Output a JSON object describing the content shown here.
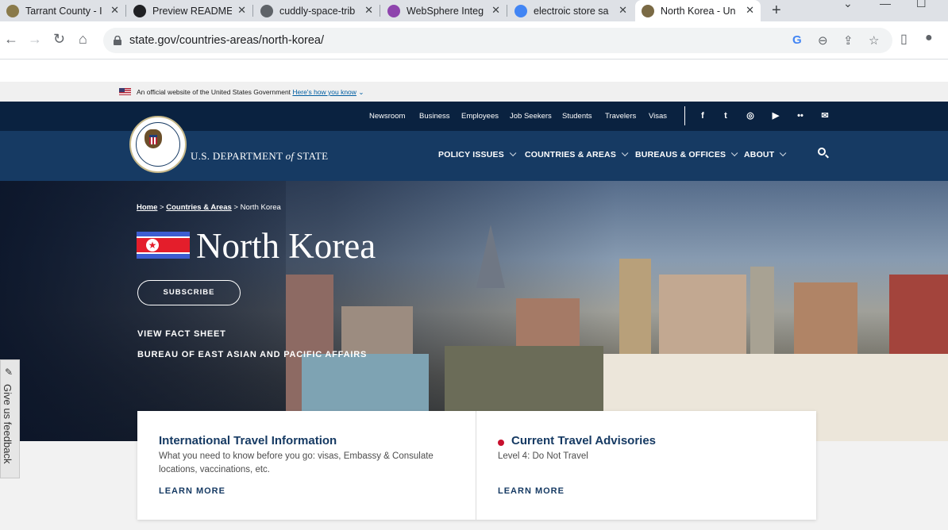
{
  "browser": {
    "tabs": [
      {
        "title": "Tarrant County - I",
        "icon_color": "#8a7a4a",
        "active": false
      },
      {
        "title": "Preview README",
        "icon_color": "#202124",
        "active": false
      },
      {
        "title": "cuddly-space-trib",
        "icon_color": "#5f6368",
        "active": false
      },
      {
        "title": "WebSphere Integ",
        "icon_color": "#8e44ad",
        "active": false
      },
      {
        "title": "electroic store sa",
        "icon_color": "#4285f4",
        "active": false
      },
      {
        "title": "North Korea - Un",
        "icon_color": "#7a6a45",
        "active": true
      }
    ],
    "url": "state.gov/countries-areas/north-korea/"
  },
  "banner": {
    "official_text": "An official website of the United States Government",
    "how_link": "Here's how you know"
  },
  "utility_nav": [
    "Newsroom",
    "Business",
    "Employees",
    "Job Seekers",
    "Students",
    "Travelers",
    "Visas"
  ],
  "social": [
    {
      "name": "facebook-icon",
      "glyph": "f"
    },
    {
      "name": "twitter-icon",
      "glyph": "t"
    },
    {
      "name": "instagram-icon",
      "glyph": "◎"
    },
    {
      "name": "youtube-icon",
      "glyph": "▶"
    },
    {
      "name": "flickr-icon",
      "glyph": "••"
    },
    {
      "name": "email-icon",
      "glyph": "✉"
    }
  ],
  "brand": {
    "pre": "U.S. DEPARTMENT ",
    "of": "of",
    "post": " STATE"
  },
  "main_nav": [
    "POLICY ISSUES",
    "COUNTRIES & AREAS",
    "BUREAUS & OFFICES",
    "ABOUT"
  ],
  "hero": {
    "breadcrumb": [
      "Home",
      "Countries & Areas",
      "North Korea"
    ],
    "sep": ">",
    "title": "North Korea",
    "subscribe": "SUBSCRIBE",
    "links": [
      "VIEW FACT SHEET",
      "BUREAU OF EAST ASIAN AND PACIFIC AFFAIRS"
    ]
  },
  "feedback": "Give us feedback",
  "cards": [
    {
      "title": "International Travel Information",
      "desc": "What you need to know before you go: visas, Embassy & Consulate locations, vaccinations, etc.",
      "link": "LEARN MORE"
    },
    {
      "title": "Current Travel Advisories",
      "desc": "Level 4: Do Not Travel",
      "link": "LEARN MORE"
    }
  ],
  "colors": {
    "navy": "#0a2240",
    "nav_blue": "#163a63",
    "alert_red": "#c8102e"
  }
}
